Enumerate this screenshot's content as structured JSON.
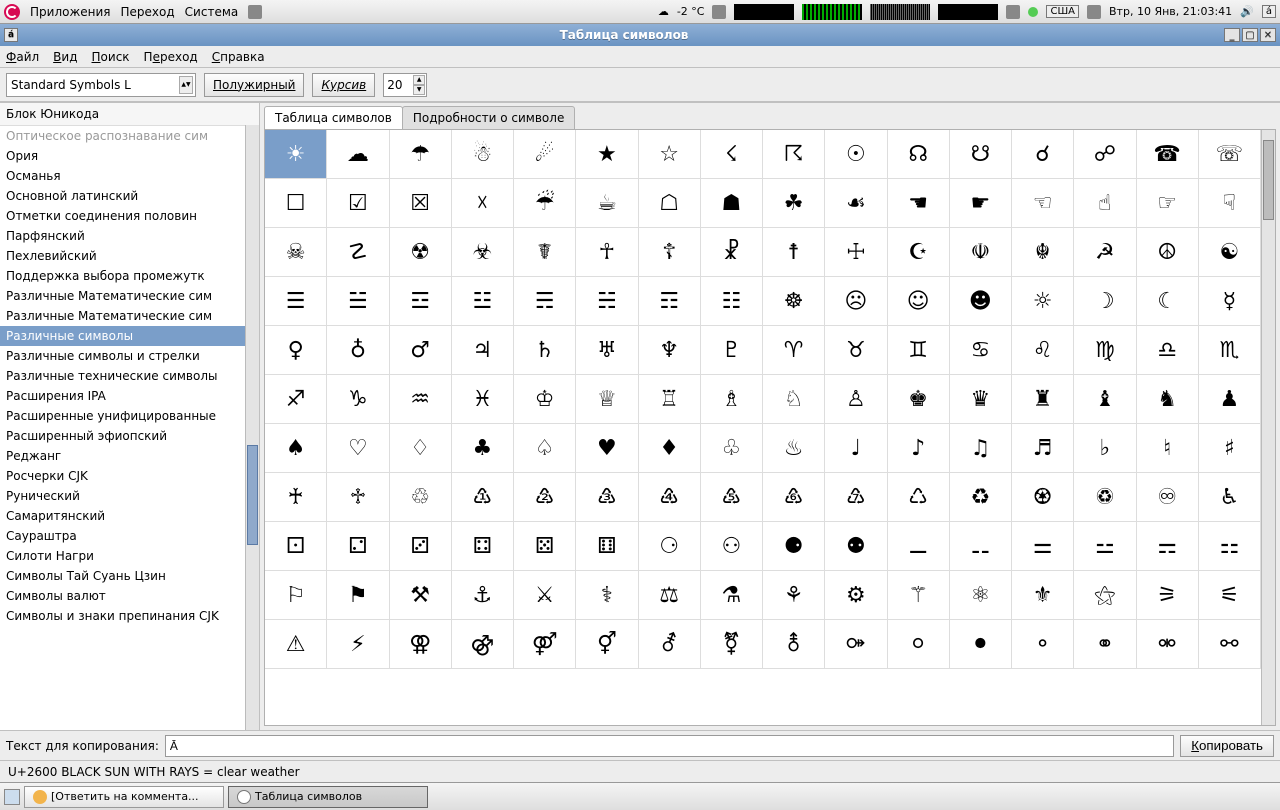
{
  "panel": {
    "apps": "Приложения",
    "places": "Переход",
    "system": "Система",
    "temp": "-2 °C",
    "kbd": "США",
    "date": "Втр, 10 Янв, 21:03:41",
    "ind": "á"
  },
  "window": {
    "title": "Таблица символов",
    "left_ind": "á"
  },
  "menu": {
    "file": "Файл",
    "view": "Вид",
    "search": "Поиск",
    "go": "Переход",
    "help": "Справка"
  },
  "toolbar": {
    "font": "Standard Symbols L",
    "bold": "Полужирный",
    "italic": "Курсив",
    "size": "20"
  },
  "sidebar": {
    "header": "Блок Юникода",
    "items": [
      {
        "label": "Оптическое распознавание сим",
        "dim": true
      },
      {
        "label": "Ория"
      },
      {
        "label": "Османья"
      },
      {
        "label": "Основной латинский"
      },
      {
        "label": "Отметки соединения половин"
      },
      {
        "label": "Парфянский"
      },
      {
        "label": "Пехлевийский"
      },
      {
        "label": "Поддержка выбора промежутк"
      },
      {
        "label": "Различные Математические сим"
      },
      {
        "label": "Различные Математические сим"
      },
      {
        "label": "Различные символы",
        "sel": true
      },
      {
        "label": "Различные символы и стрелки"
      },
      {
        "label": "Различные технические символы"
      },
      {
        "label": "Расширения IPA"
      },
      {
        "label": "Расширенные унифицированные"
      },
      {
        "label": "Расширенный эфиопский"
      },
      {
        "label": "Реджанг"
      },
      {
        "label": "Росчерки CJK"
      },
      {
        "label": "Рунический"
      },
      {
        "label": "Самаритянский"
      },
      {
        "label": "Саураштра"
      },
      {
        "label": "Силоти Нагри"
      },
      {
        "label": "Символы Тай Суань Цзин"
      },
      {
        "label": "Символы валют"
      },
      {
        "label": "Символы и знаки препинания CJK"
      }
    ]
  },
  "tabs": {
    "chars": "Таблица символов",
    "details": "Подробности о символе"
  },
  "chars": [
    "☀",
    "☁",
    "☂",
    "☃",
    "☄",
    "★",
    "☆",
    "☇",
    "☈",
    "☉",
    "☊",
    "☋",
    "☌",
    "☍",
    "☎",
    "☏",
    "☐",
    "☑",
    "☒",
    "☓",
    "☔",
    "☕",
    "☖",
    "☗",
    "☘",
    "☙",
    "☚",
    "☛",
    "☜",
    "☝",
    "☞",
    "☟",
    "☠",
    "☡",
    "☢",
    "☣",
    "☤",
    "☥",
    "☦",
    "☧",
    "☨",
    "☩",
    "☪",
    "☫",
    "☬",
    "☭",
    "☮",
    "☯",
    "☰",
    "☱",
    "☲",
    "☳",
    "☴",
    "☵",
    "☶",
    "☷",
    "☸",
    "☹",
    "☺",
    "☻",
    "☼",
    "☽",
    "☾",
    "☿",
    "♀",
    "♁",
    "♂",
    "♃",
    "♄",
    "♅",
    "♆",
    "♇",
    "♈",
    "♉",
    "♊",
    "♋",
    "♌",
    "♍",
    "♎",
    "♏",
    "♐",
    "♑",
    "♒",
    "♓",
    "♔",
    "♕",
    "♖",
    "♗",
    "♘",
    "♙",
    "♚",
    "♛",
    "♜",
    "♝",
    "♞",
    "♟",
    "♠",
    "♡",
    "♢",
    "♣",
    "♤",
    "♥",
    "♦",
    "♧",
    "♨",
    "♩",
    "♪",
    "♫",
    "♬",
    "♭",
    "♮",
    "♯",
    "♰",
    "♱",
    "♲",
    "♳",
    "♴",
    "♵",
    "♶",
    "♷",
    "♸",
    "♹",
    "♺",
    "♻",
    "♼",
    "♽",
    "♾",
    "♿",
    "⚀",
    "⚁",
    "⚂",
    "⚃",
    "⚄",
    "⚅",
    "⚆",
    "⚇",
    "⚈",
    "⚉",
    "⚊",
    "⚋",
    "⚌",
    "⚍",
    "⚎",
    "⚏",
    "⚐",
    "⚑",
    "⚒",
    "⚓",
    "⚔",
    "⚕",
    "⚖",
    "⚗",
    "⚘",
    "⚙",
    "⚚",
    "⚛",
    "⚜",
    "⚝",
    "⚞",
    "⚟",
    "⚠",
    "⚡",
    "⚢",
    "⚣",
    "⚤",
    "⚥",
    "⚦",
    "⚧",
    "⚨",
    "⚩",
    "⚪",
    "⚫",
    "⚬",
    "⚭",
    "⚮",
    "⚯"
  ],
  "copy": {
    "label": "Текст для копирования:",
    "value": "Ā",
    "button": "Копировать"
  },
  "status": "U+2600 BLACK SUN WITH RAYS   = clear weather",
  "taskbar": {
    "item1": "[Ответить на коммента...",
    "item2": "Таблица символов"
  }
}
